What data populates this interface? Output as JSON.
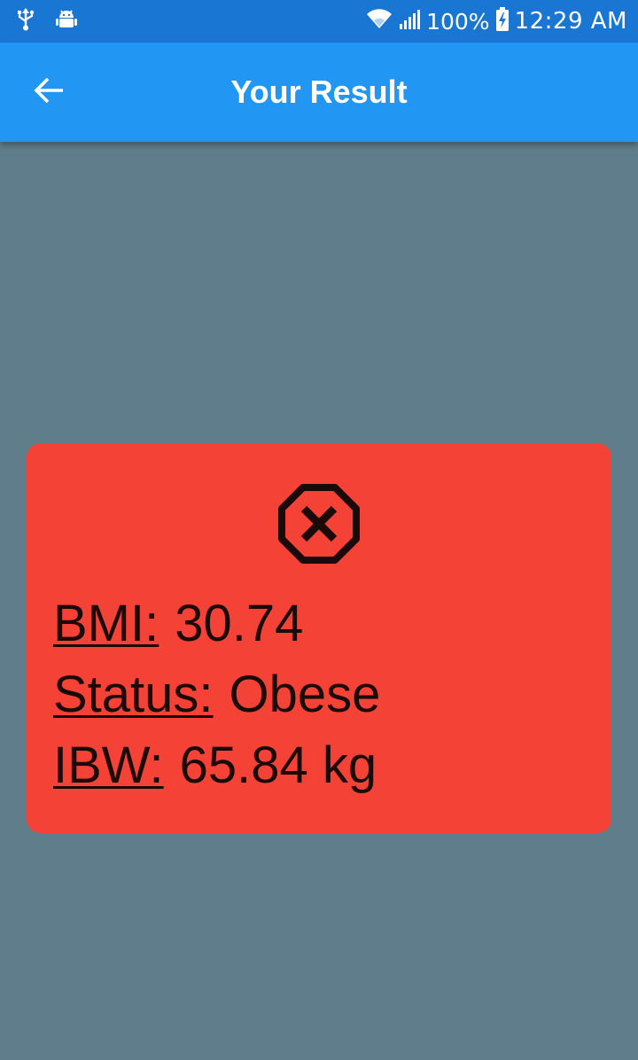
{
  "status_bar": {
    "battery": "100%",
    "time": "12:29 AM",
    "icons": [
      "usb-icon",
      "android-debug-icon",
      "wifi-icon",
      "signal-icon",
      "battery-charging-icon"
    ]
  },
  "app_bar": {
    "title": "Your Result",
    "back_icon": "arrow-back-icon",
    "color": "#2196f3"
  },
  "result": {
    "icon": "octagon-x-icon",
    "card_color": "#f44336",
    "bmi_label": "BMI:",
    "bmi_value": "30.74",
    "status_label": "Status:",
    "status_value": "Obese",
    "ibw_label": "IBW:",
    "ibw_value": "65.84 kg"
  },
  "background_color": "#607d8b"
}
